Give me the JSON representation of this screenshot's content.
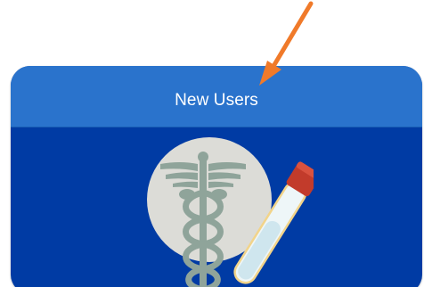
{
  "tile": {
    "title": "New Users",
    "icon": "caduceus-test-tube-icon"
  },
  "annotation": {
    "icon": "arrow-pointer-icon"
  },
  "colors": {
    "tile_header": "#2a73cc",
    "tile_body": "#003ba4",
    "icon_circle": "#dcdcd7",
    "caduceus": "#8fa49a",
    "tube_cap": "#c23b2b",
    "arrow": "#f07a2a"
  }
}
